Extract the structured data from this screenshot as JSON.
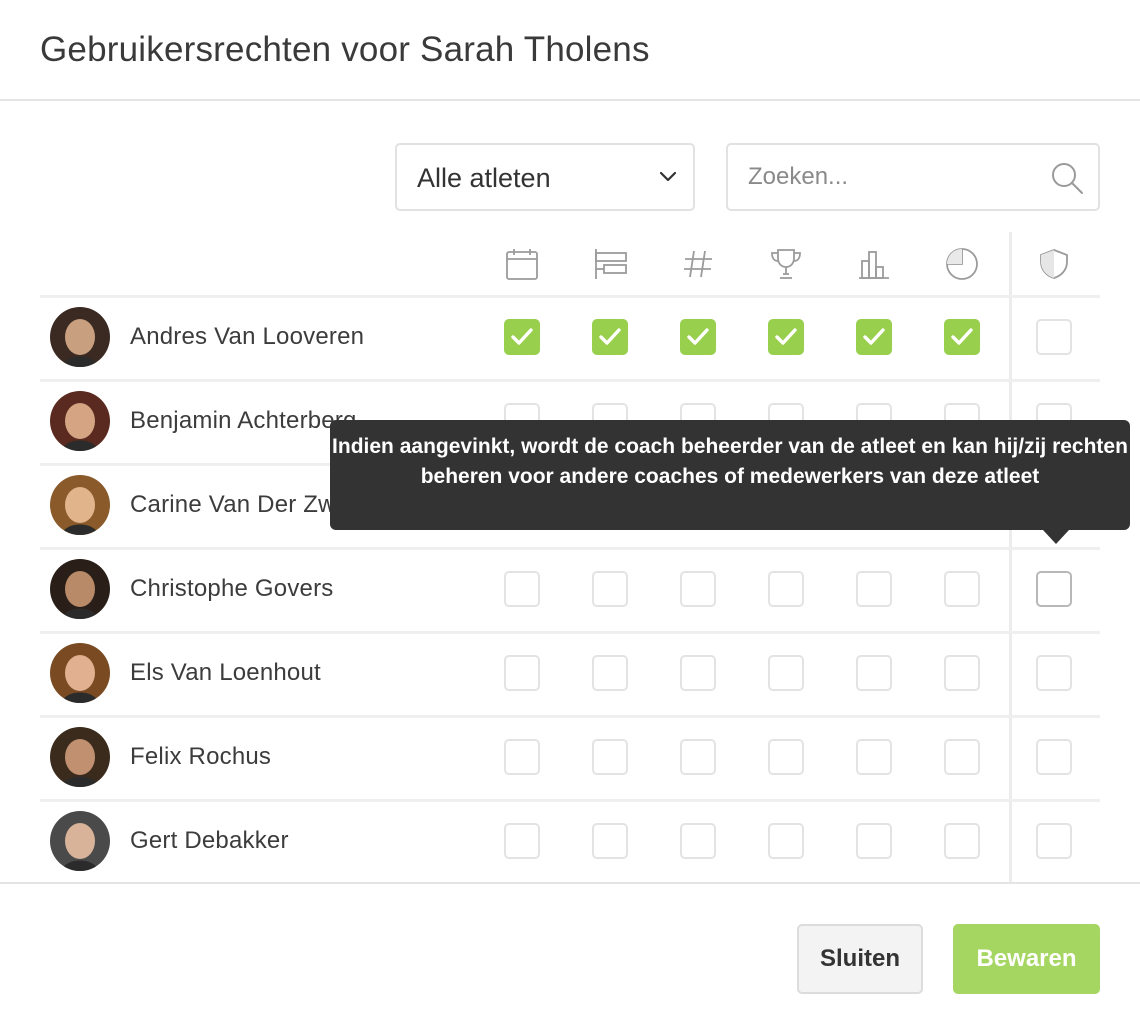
{
  "dialog": {
    "title": "Gebruikersrechten voor Sarah Tholens"
  },
  "filter": {
    "selected": "Alle atleten"
  },
  "search": {
    "placeholder": "Zoeken..."
  },
  "columns": [
    {
      "icon": "calendar-icon"
    },
    {
      "icon": "planning-icon"
    },
    {
      "icon": "hashtag-icon"
    },
    {
      "icon": "trophy-icon"
    },
    {
      "icon": "bar-chart-icon"
    },
    {
      "icon": "pie-chart-icon"
    },
    {
      "icon": "shield-icon"
    }
  ],
  "athletes": [
    {
      "name": "Andres Van Looveren",
      "permissions": [
        true,
        true,
        true,
        true,
        true,
        true,
        false
      ]
    },
    {
      "name": "Benjamin Achterberg",
      "permissions": [
        false,
        false,
        false,
        false,
        false,
        false,
        false
      ]
    },
    {
      "name": "Carine Van Der Zwaan",
      "permissions": [
        false,
        false,
        false,
        false,
        false,
        false,
        false
      ]
    },
    {
      "name": "Christophe Govers",
      "permissions": [
        false,
        false,
        false,
        false,
        false,
        false,
        false
      ]
    },
    {
      "name": "Els Van Loenhout",
      "permissions": [
        false,
        false,
        false,
        false,
        false,
        false,
        false
      ]
    },
    {
      "name": "Felix Rochus",
      "permissions": [
        false,
        false,
        false,
        false,
        false,
        false,
        false
      ]
    },
    {
      "name": "Gert Debakker",
      "permissions": [
        false,
        false,
        false,
        false,
        false,
        false,
        false
      ]
    }
  ],
  "tooltip": {
    "text": "Indien aangevinkt, wordt de coach beheerder van de atleet en kan hij/zij rechten beheren voor andere coaches of medewerkers van deze atleet"
  },
  "footer": {
    "close_label": "Sluiten",
    "save_label": "Bewaren"
  },
  "colors": {
    "accent": "#a6d662",
    "checked": "#98cf4d",
    "tooltip_bg": "#333333"
  }
}
